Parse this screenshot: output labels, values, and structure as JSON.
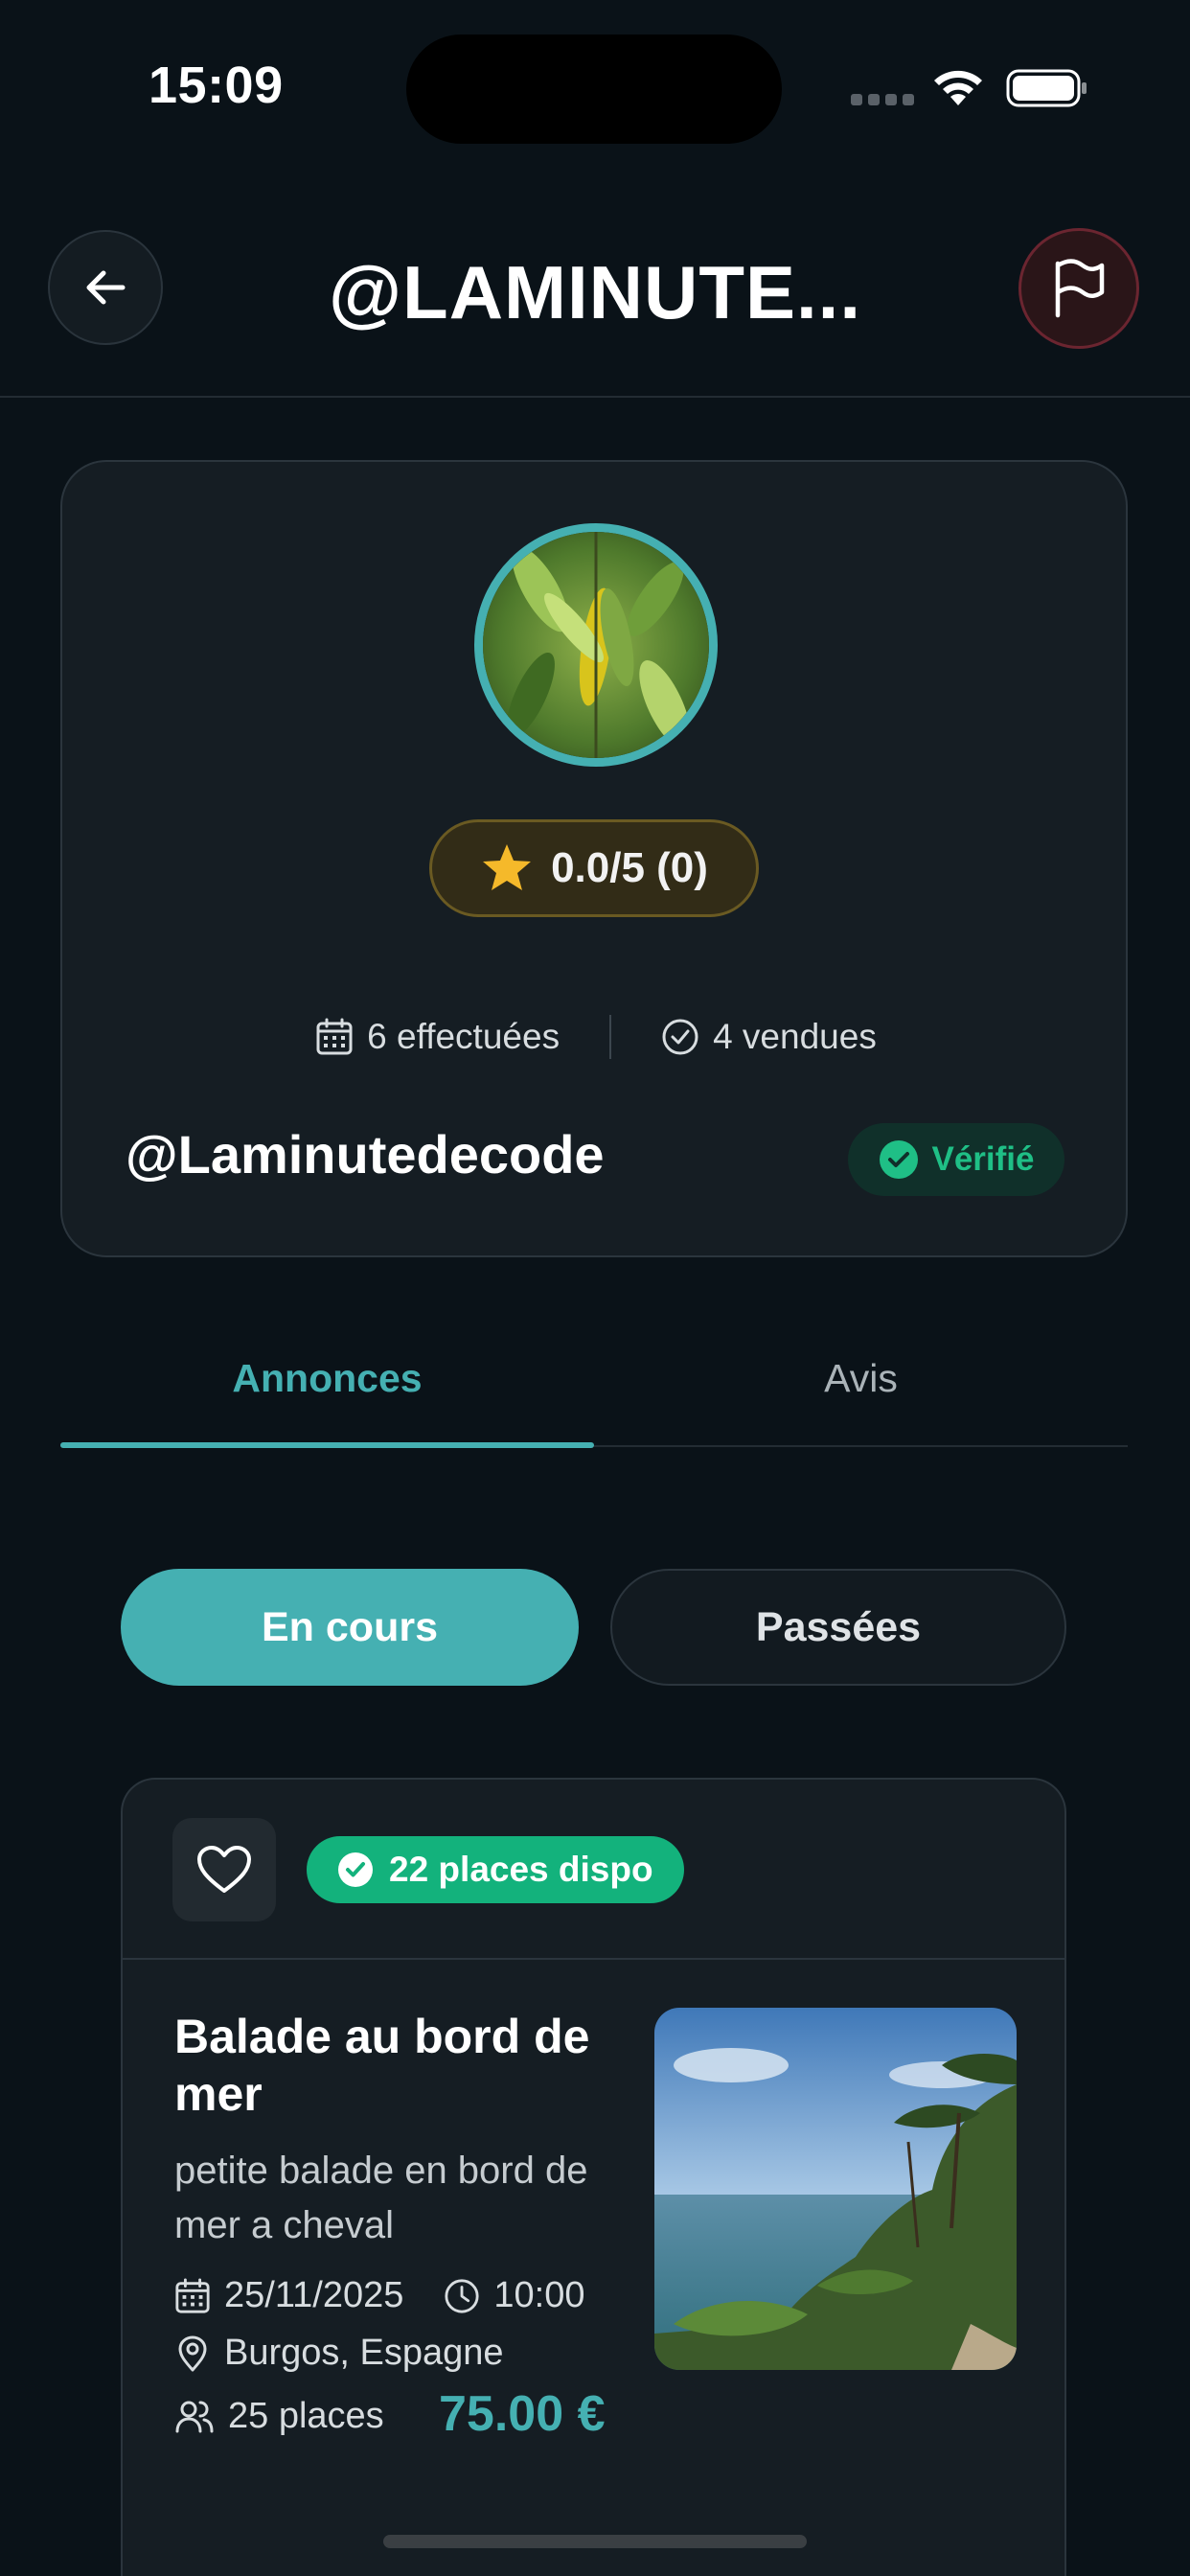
{
  "status_bar": {
    "time": "15:09"
  },
  "header": {
    "title": "@LAMINUTE...",
    "back_icon": "arrow-left-icon",
    "report_icon": "flag-icon"
  },
  "profile": {
    "rating": "0.0/5 (0)",
    "stats": {
      "completed": "6 effectuées",
      "sold": "4 vendues"
    },
    "username": "@Laminutedecode",
    "verified_label": "Vérifié"
  },
  "tabs": [
    {
      "label": "Annonces",
      "active": true
    },
    {
      "label": "Avis",
      "active": false
    }
  ],
  "filters": {
    "active": "En cours",
    "inactive": "Passées"
  },
  "listing": {
    "availability": "22 places dispo",
    "title": "Balade au bord de mer",
    "description": "petite balade en bord de mer a cheval",
    "date": "25/11/2025",
    "time": "10:00",
    "location": "Burgos, Espagne",
    "places": "25 places",
    "price": "75.00 €"
  },
  "colors": {
    "accent": "#45b0b2",
    "success": "#13b27c",
    "rating_star": "#f5b92a",
    "background": "#0a1218",
    "card": "#151d23"
  }
}
